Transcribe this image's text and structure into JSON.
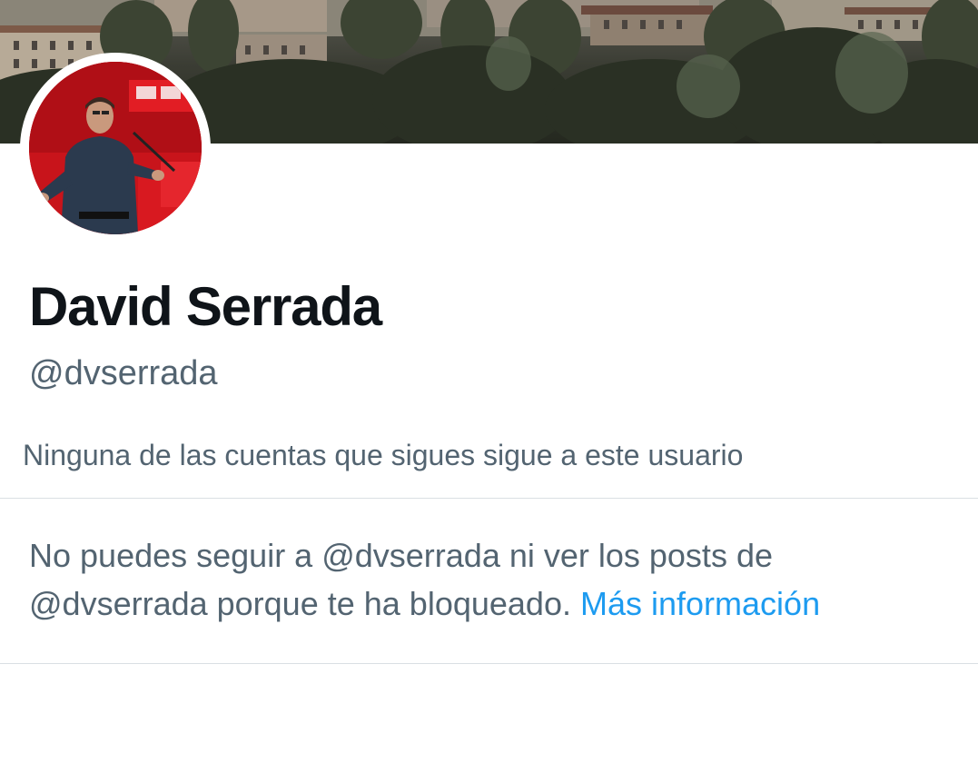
{
  "profile": {
    "display_name": "David Serrada",
    "handle": "@dvserrada",
    "mutuals_notice": "Ninguna de las cuentas que sigues sigue a este usuario"
  },
  "blocked_notice": {
    "line1": "No puedes seguir a @dvserrada ni ver los posts de",
    "line2_text": "@dvserrada porque te ha bloqueado.",
    "link_label": "Más información"
  },
  "colors": {
    "primary_text": "#0f1419",
    "secondary_text": "#536471",
    "link": "#1d9bf0",
    "divider": "#dadfe3"
  }
}
